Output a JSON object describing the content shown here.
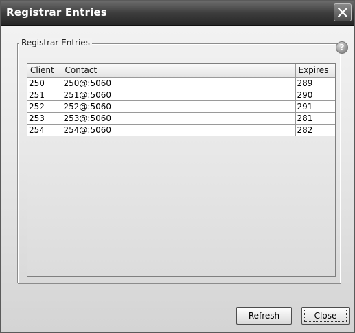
{
  "window": {
    "title": "Registrar Entries"
  },
  "group": {
    "label": "Registrar Entries"
  },
  "table": {
    "headers": [
      "Client",
      "Contact",
      "Expires"
    ],
    "rows": [
      [
        "250",
        "250@:5060",
        "289"
      ],
      [
        "251",
        "251@:5060",
        "290"
      ],
      [
        "252",
        "252@:5060",
        "291"
      ],
      [
        "253",
        "253@:5060",
        "281"
      ],
      [
        "254",
        "254@:5060",
        "282"
      ]
    ]
  },
  "buttons": {
    "refresh": "Refresh",
    "close": "Close"
  },
  "icons": {
    "help": "question-mark",
    "close_window": "x-mark"
  },
  "help_glyph": "?"
}
